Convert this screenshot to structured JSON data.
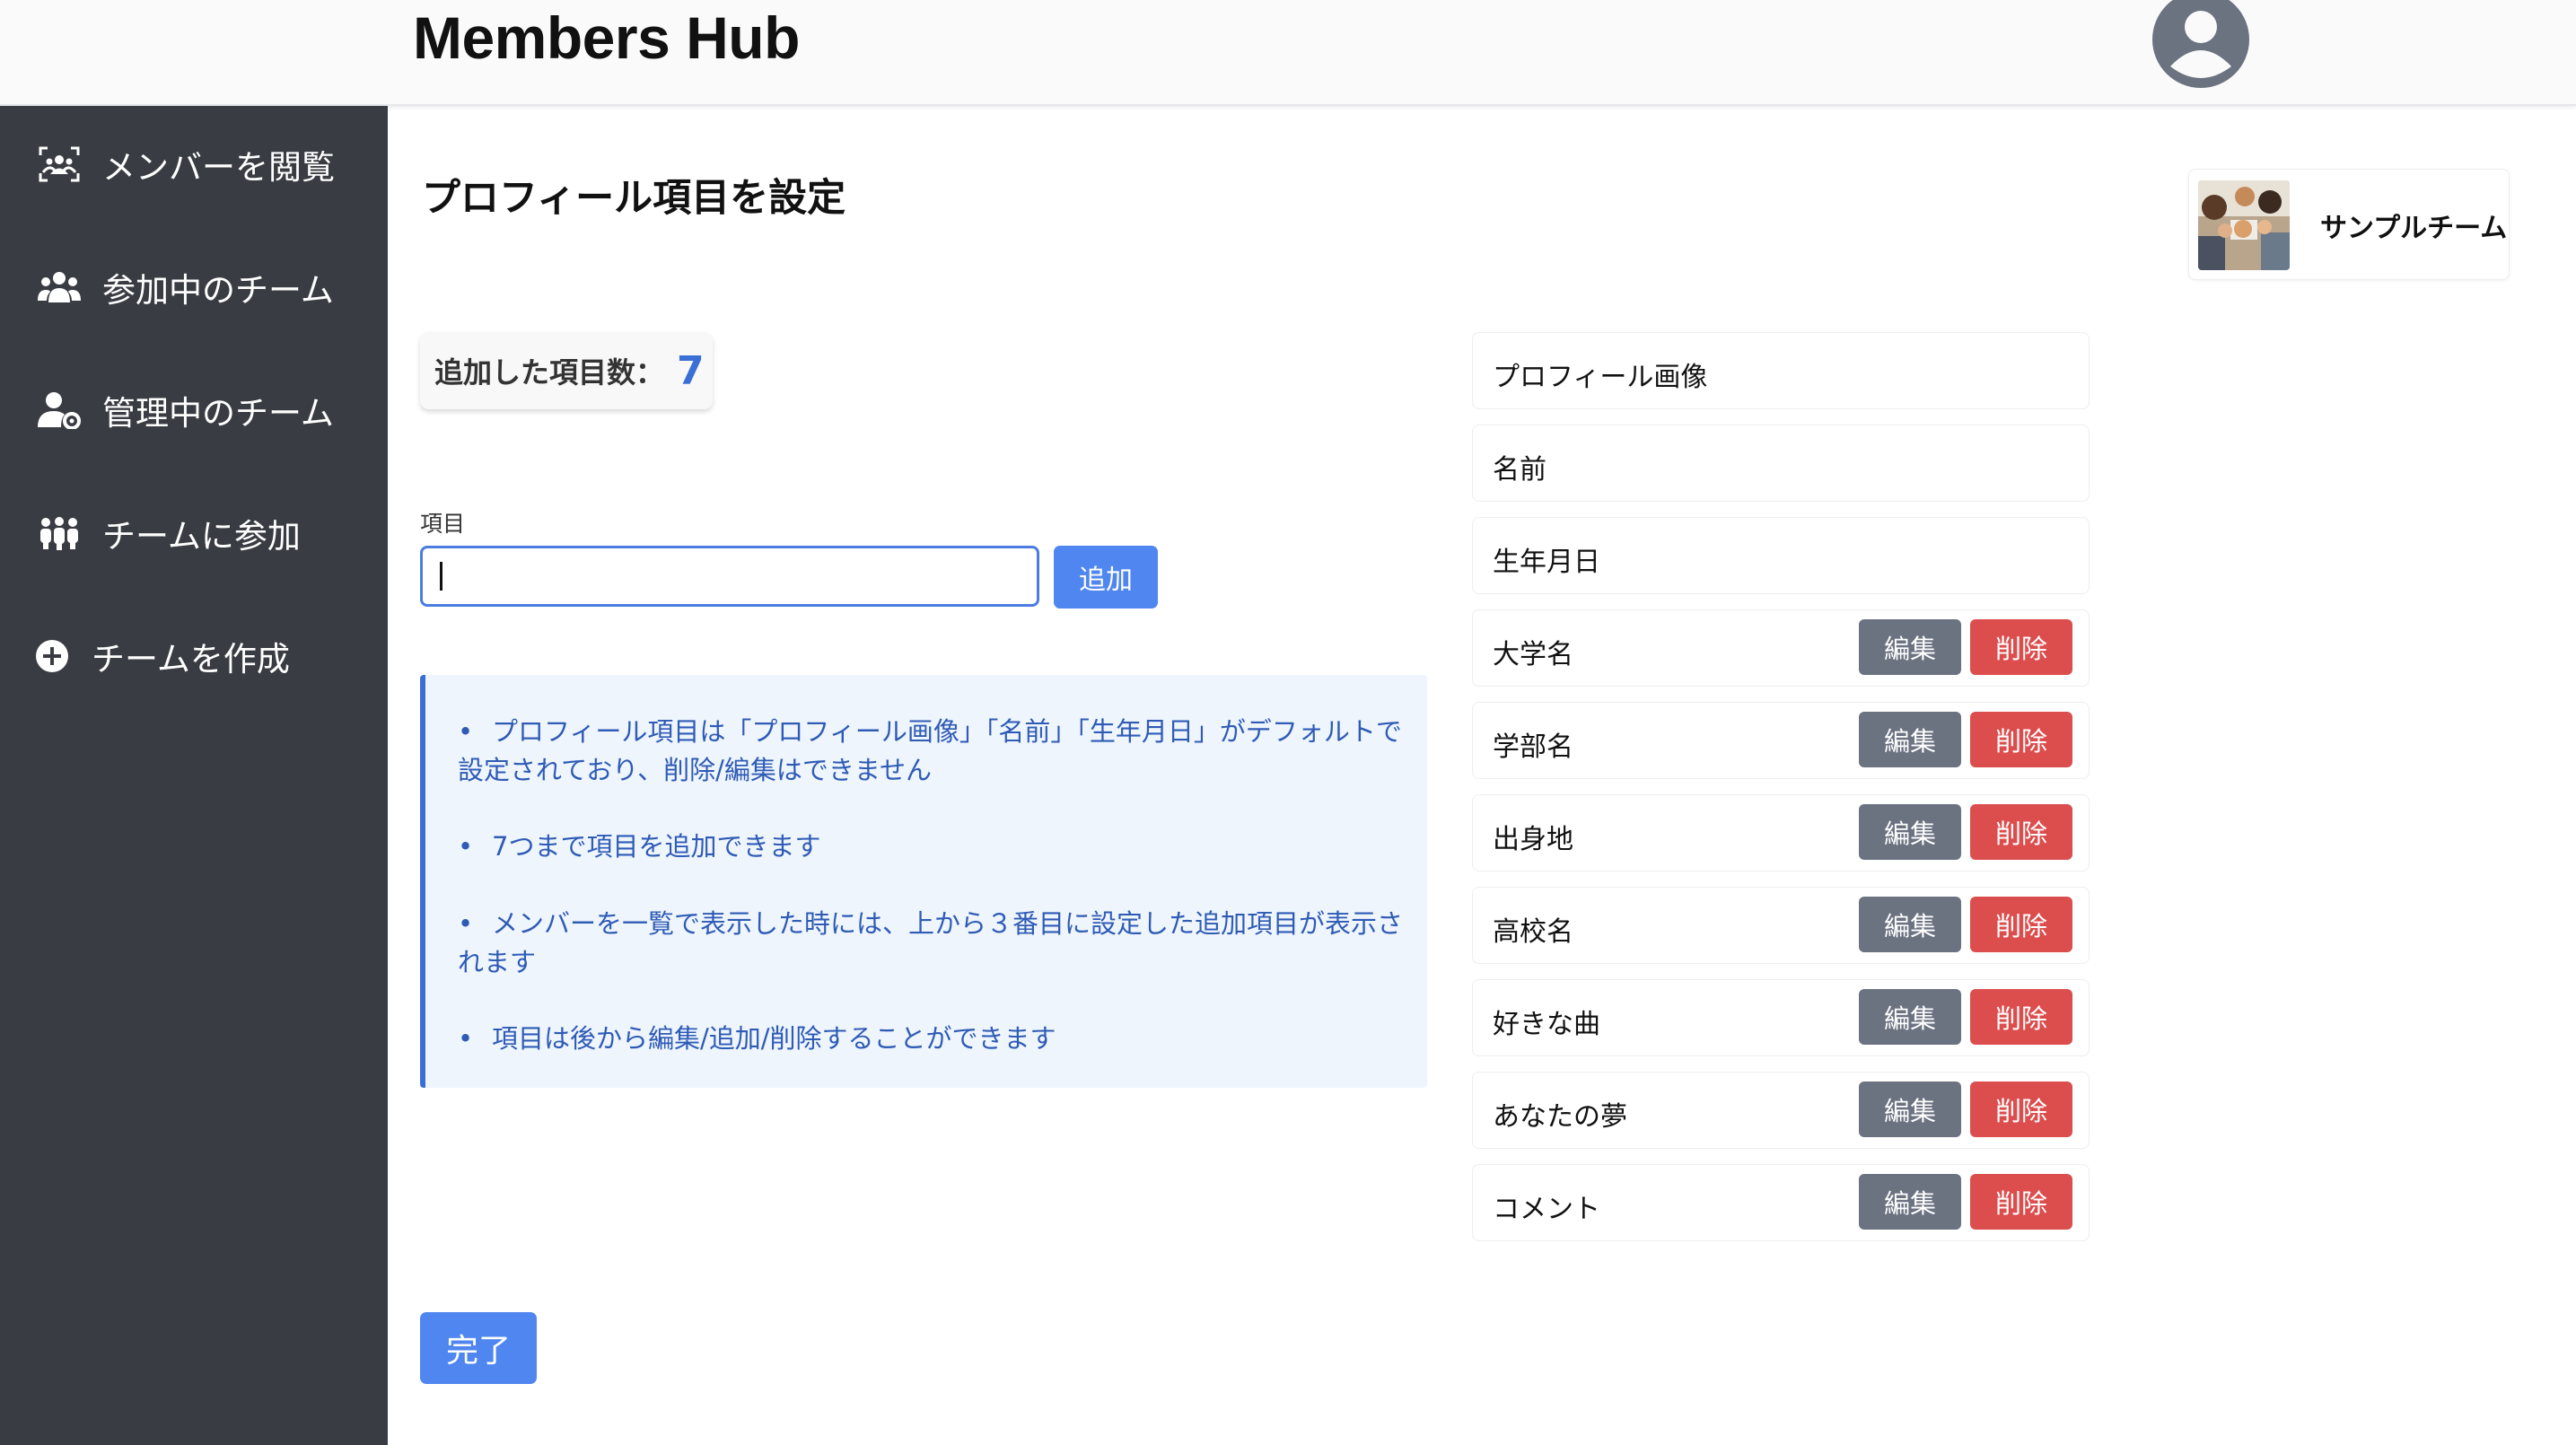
{
  "app": {
    "title": "Members Hub"
  },
  "sidebar": {
    "items": [
      {
        "label": "メンバーを閲覧",
        "icon": "members-scan-icon"
      },
      {
        "label": "参加中のチーム",
        "icon": "group-icon"
      },
      {
        "label": "管理中のチーム",
        "icon": "user-manage-icon"
      },
      {
        "label": "チームに参加",
        "icon": "people-join-icon"
      },
      {
        "label": "チームを作成",
        "icon": "plus-circle-icon"
      }
    ]
  },
  "main": {
    "title": "プロフィール項目を設定",
    "count_label": "追加した項目数：",
    "count_value": "7",
    "field_label": "項目",
    "input_value": "",
    "add_label": "追加",
    "done_label": "完了",
    "info": [
      "プロフィール項目は「プロフィール画像」「名前」「生年月日」がデフォルトで設定されており、削除/編集はできません",
      "7つまで項目を追加できます",
      "メンバーを一覧で表示した時には、上から３番目に設定した追加項目が表示されます",
      "項目は後から編集/追加/削除することができます"
    ]
  },
  "team": {
    "name": "サンプルチーム"
  },
  "buttons": {
    "edit": "編集",
    "delete": "削除"
  },
  "fields": {
    "default": [
      "プロフィール画像",
      "名前",
      "生年月日"
    ],
    "custom": [
      "大学名",
      "学部名",
      "出身地",
      "高校名",
      "好きな曲",
      "あなたの夢",
      "コメント"
    ]
  },
  "colors": {
    "sidebar": "#3a3c43",
    "primary": "#4f86ef",
    "edit": "#6b7280",
    "delete": "#dc4d4d",
    "info_bg": "#eef5fd",
    "info_text": "#2f5bb5"
  }
}
